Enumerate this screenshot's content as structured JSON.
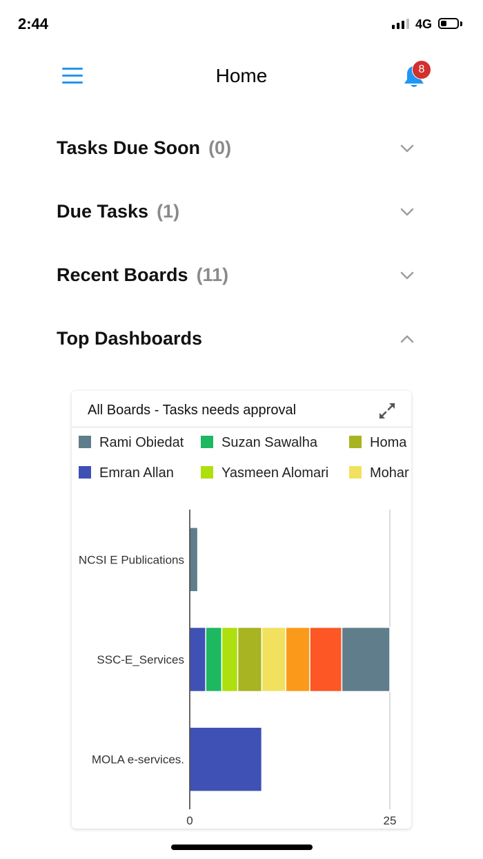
{
  "status_bar": {
    "time": "2:44",
    "network": "4G",
    "battery_level": 0.35
  },
  "header": {
    "title": "Home",
    "notification_count": "8"
  },
  "sections": [
    {
      "title": "Tasks Due Soon",
      "count": "(0)",
      "expanded": false
    },
    {
      "title": "Due Tasks",
      "count": "(1)",
      "expanded": false
    },
    {
      "title": "Recent Boards",
      "count": "(11)",
      "expanded": false
    },
    {
      "title": "Top Dashboards",
      "count": "",
      "expanded": true
    }
  ],
  "card": {
    "title": "All Boards - Tasks needs approval"
  },
  "legend": [
    {
      "name": "Rami Obiedat",
      "color": "#607d8b"
    },
    {
      "name": "Suzan Sawalha",
      "color": "#1db860"
    },
    {
      "name": "Homa",
      "color": "#a8b421"
    },
    {
      "name": "Emran Allan",
      "color": "#3f51b5"
    },
    {
      "name": "Yasmeen Alomari",
      "color": "#aedf0e"
    },
    {
      "name": "Mohar",
      "color": "#f2e15f"
    }
  ],
  "chart_data": {
    "type": "bar",
    "orientation": "horizontal",
    "stacked": true,
    "categories": [
      "NCSI E Publications",
      "SSC-E_Services",
      "MOLA e-services."
    ],
    "x_ticks": [
      "0",
      "25"
    ],
    "xlim": [
      0,
      25
    ],
    "segments": [
      [
        {
          "value": 1,
          "color": "#607d8b"
        }
      ],
      [
        {
          "value": 2,
          "color": "#3f51b5"
        },
        {
          "value": 2,
          "color": "#1db860"
        },
        {
          "value": 2,
          "color": "#aedf0e"
        },
        {
          "value": 3,
          "color": "#a8b421"
        },
        {
          "value": 3,
          "color": "#f2e15f"
        },
        {
          "value": 3,
          "color": "#fb9a1a"
        },
        {
          "value": 4,
          "color": "#fc5724"
        },
        {
          "value": 6,
          "color": "#607d8b"
        }
      ],
      [
        {
          "value": 9,
          "color": "#3f51b5"
        }
      ]
    ],
    "grid": false
  },
  "icons": {
    "menu": "hamburger-menu-icon",
    "notifications": "bell-icon",
    "collapsed": "chevron-down-icon",
    "expanded": "chevron-up-icon",
    "expand": "expand-icon"
  },
  "colors": {
    "accent": "#2196f3",
    "badge": "#d32f2f"
  }
}
